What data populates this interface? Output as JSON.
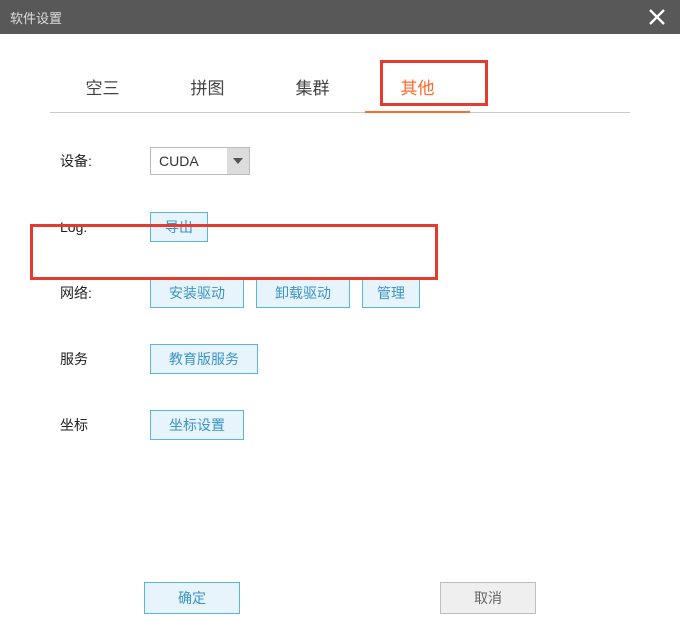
{
  "window": {
    "title": "软件设置"
  },
  "tabs": [
    {
      "label": "空三",
      "active": false
    },
    {
      "label": "拼图",
      "active": false
    },
    {
      "label": "集群",
      "active": false
    },
    {
      "label": "其他",
      "active": true
    }
  ],
  "rows": {
    "device": {
      "label": "设备:",
      "value": "CUDA"
    },
    "log": {
      "label": "Log:",
      "export_label": "导出"
    },
    "network": {
      "label": "网络:",
      "install_label": "安装驱动",
      "uninstall_label": "卸载驱动",
      "manage_label": "管理"
    },
    "service": {
      "label": "服务",
      "edu_label": "教育版服务"
    },
    "coord": {
      "label": "坐标",
      "settings_label": "坐标设置"
    }
  },
  "footer": {
    "ok": "确定",
    "cancel": "取消"
  }
}
